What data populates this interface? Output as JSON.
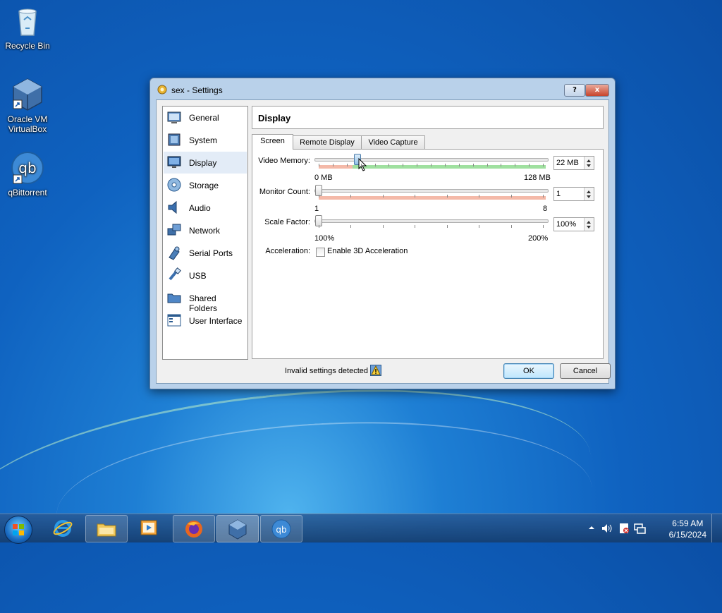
{
  "desktop": {
    "icons": [
      {
        "label": "Recycle Bin"
      },
      {
        "label": "Oracle VM VirtualBox"
      },
      {
        "label": "qBittorrent"
      }
    ]
  },
  "dialog": {
    "title": "sex - Settings",
    "help_button": "?",
    "close_button": "x",
    "sidebar": {
      "items": [
        {
          "label": "General",
          "icon": "general-icon"
        },
        {
          "label": "System",
          "icon": "system-icon"
        },
        {
          "label": "Display",
          "icon": "display-icon",
          "selected": true
        },
        {
          "label": "Storage",
          "icon": "storage-icon"
        },
        {
          "label": "Audio",
          "icon": "audio-icon"
        },
        {
          "label": "Network",
          "icon": "network-icon"
        },
        {
          "label": "Serial Ports",
          "icon": "serial-ports-icon"
        },
        {
          "label": "USB",
          "icon": "usb-icon"
        },
        {
          "label": "Shared Folders",
          "icon": "shared-folders-icon"
        },
        {
          "label": "User Interface",
          "icon": "user-interface-icon"
        }
      ]
    },
    "page_title": "Display",
    "tabs": [
      {
        "label": "Screen",
        "active": true
      },
      {
        "label": "Remote Display"
      },
      {
        "label": "Video Capture"
      }
    ],
    "screen": {
      "video_memory": {
        "label": "Video Memory:",
        "value": "22 MB",
        "min_label": "0 MB",
        "max_label": "128 MB",
        "level": 22,
        "max": 128
      },
      "monitor_count": {
        "label": "Monitor Count:",
        "value": "1",
        "min_label": "1",
        "max_label": "8",
        "level": 1,
        "max": 8
      },
      "scale_factor": {
        "label": "Scale Factor:",
        "value": "100%",
        "min_label": "100%",
        "max_label": "200%",
        "level": 100,
        "max": 200
      },
      "acceleration": {
        "label": "Acceleration:",
        "checkbox_label": "Enable 3D Acceleration",
        "checked": false
      }
    },
    "status": {
      "text": "Invalid settings detected",
      "icon": "warning-icon"
    },
    "ok_label": "OK",
    "cancel_label": "Cancel"
  },
  "taskbar": {
    "pinned": [
      "internet-explorer-icon",
      "file-explorer-icon",
      "media-player-icon",
      "firefox-icon",
      "virtualbox-icon",
      "qbittorrent-icon"
    ],
    "tray": {
      "time": "6:59 AM",
      "date": "6/15/2024"
    }
  },
  "colors": {
    "accent": "#1e7fd4",
    "green_range": "#9fe09f",
    "red_range": "#f4b9a8"
  }
}
